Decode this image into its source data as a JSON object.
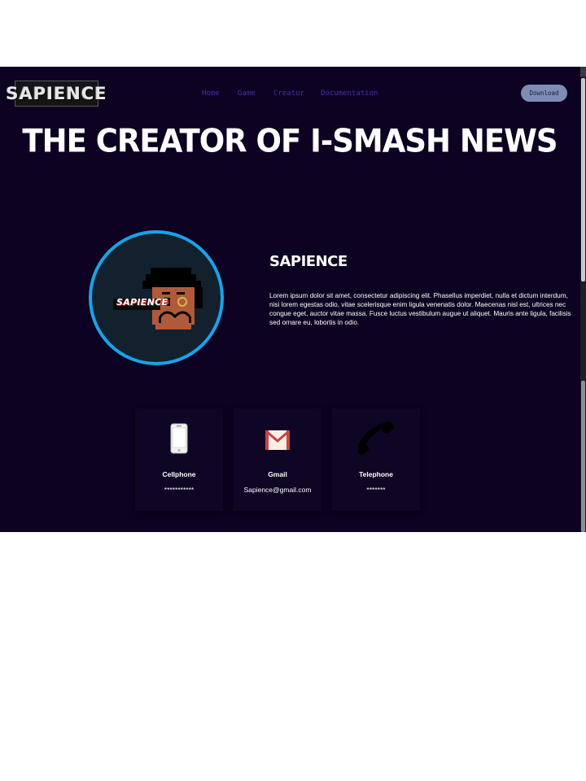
{
  "brand": {
    "logo_text": "SAPIENCE"
  },
  "nav": {
    "links": [
      {
        "label": "Home"
      },
      {
        "label": "Game"
      },
      {
        "label": "Creator"
      },
      {
        "label": "Documentation"
      }
    ],
    "download_label": "Download"
  },
  "page": {
    "title": "THE CREATOR OF I-SMASH NEWS"
  },
  "profile": {
    "avatar_text": "SAPIENCE",
    "name": "SAPIENCE",
    "bio": "Lorem ipsum dolor sit amet, consectetur adipiscing elit. Phasellus imperdiet, nulla et dictum interdum, nisi lorem egestas odio, vitae scelerisque enim ligula venenatis dolor. Maecenas nisl est, ultrices nec congue eget, auctor vitae massa. Fusce luctus vestibulum augue ut aliquet. Mauris ante ligula, facilisis sed ornare eu, lobortis in odio."
  },
  "contacts": [
    {
      "icon": "phone-icon",
      "label": "Cellphone",
      "value": "***********"
    },
    {
      "icon": "gmail-icon",
      "label": "Gmail",
      "value": "Sapience@gmail.com"
    },
    {
      "icon": "telephone-icon",
      "label": "Telephone",
      "value": "*******"
    }
  ],
  "colors": {
    "background": "#0d0221",
    "nav_link": "#4b2bb5",
    "avatar_ring": "#1aa3e8",
    "download_button": "#7d8db5"
  }
}
